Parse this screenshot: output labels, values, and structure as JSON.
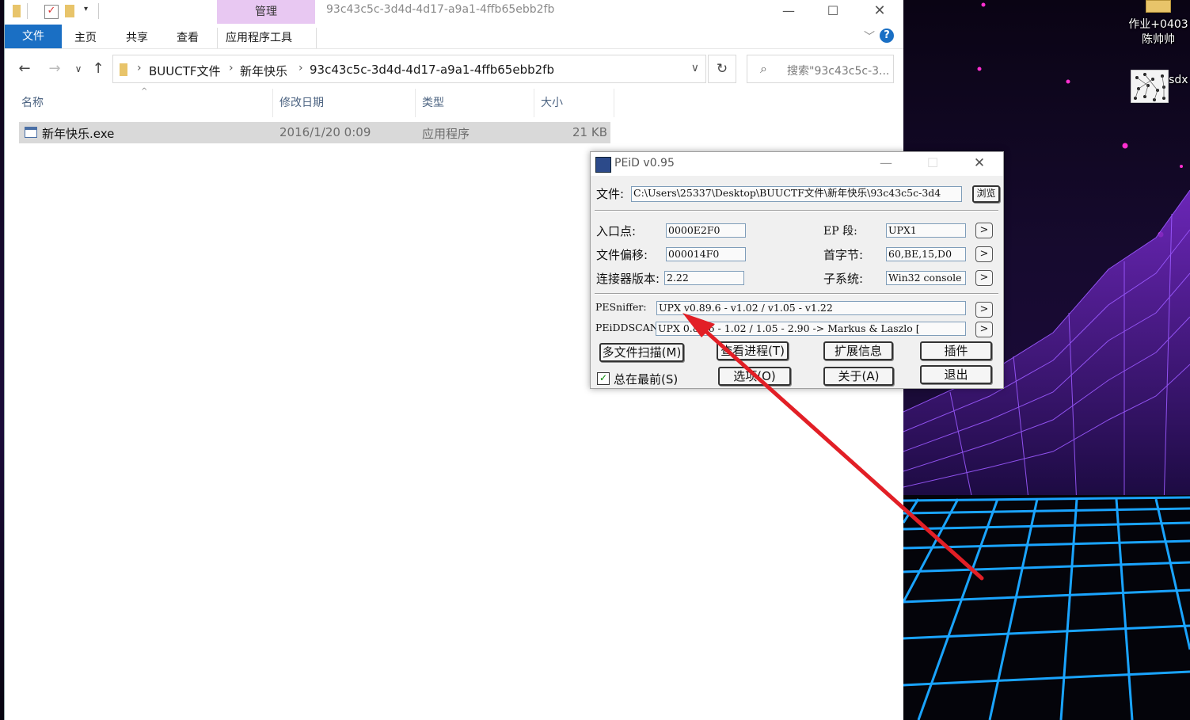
{
  "desktop": {
    "icons": [
      {
        "label_line1": "作业+0403",
        "label_line2": "陈帅帅"
      },
      {
        "label": "计网.vsdx"
      }
    ]
  },
  "explorer": {
    "manage_tab": "管理",
    "window_title": "93c43c5c-3d4d-4d17-a9a1-4ffb65ebb2fb",
    "ribbon_tabs": [
      "文件",
      "主页",
      "共享",
      "查看",
      "应用程序工具"
    ],
    "breadcrumb": [
      "BUUCTF文件",
      "新年快乐",
      "93c43c5c-3d4d-4d17-a9a1-4ffb65ebb2fb"
    ],
    "search_placeholder": "搜索\"93c43c5c-3...",
    "columns": [
      "名称",
      "修改日期",
      "类型",
      "大小"
    ],
    "files": [
      {
        "name": "新年快乐.exe",
        "modified": "2016/1/20 0:09",
        "type": "应用程序",
        "size": "21 KB"
      }
    ],
    "colors": {
      "accent": "#1a6fc4",
      "manage_tab": "#e8c8f2",
      "selected_row": "#d9d9d9"
    }
  },
  "peid": {
    "title": "PEiD v0.95",
    "file_label": "文件:",
    "file_path": "C:\\Users\\25337\\Desktop\\BUUCTF文件\\新年快乐\\93c43c5c-3d4",
    "browse": "浏览",
    "entry_point_label": "入口点:",
    "entry_point": "0000E2F0",
    "ep_section_label": "EP 段:",
    "ep_section": "UPX1",
    "file_offset_label": "文件偏移:",
    "file_offset": "000014F0",
    "first_bytes_label": "首字节:",
    "first_bytes": "60,BE,15,D0",
    "linker_label": "连接器版本:",
    "linker": "2.22",
    "subsystem_label": "子系统:",
    "subsystem": "Win32 console",
    "pesniffer_label": "PESniffer:",
    "pesniffer": "UPX v0.89.6 - v1.02 / v1.05 - v1.22",
    "peiddscan_label": "PEiDDSCAN:",
    "peiddscan": "UPX 0.89.6 - 1.02 / 1.05 - 2.90 -> Markus & Laszlo [",
    "buttons": {
      "multi_scan": "多文件扫描(M)",
      "view_process": "查看进程(T)",
      "ext_info": "扩展信息",
      "plugins": "插件",
      "options": "选项(O)",
      "about": "关于(A)",
      "exit": "退出"
    },
    "always_on_top": "总在最前(S)",
    "always_on_top_checked": true
  },
  "annotation": {
    "color": "#e21f26"
  }
}
